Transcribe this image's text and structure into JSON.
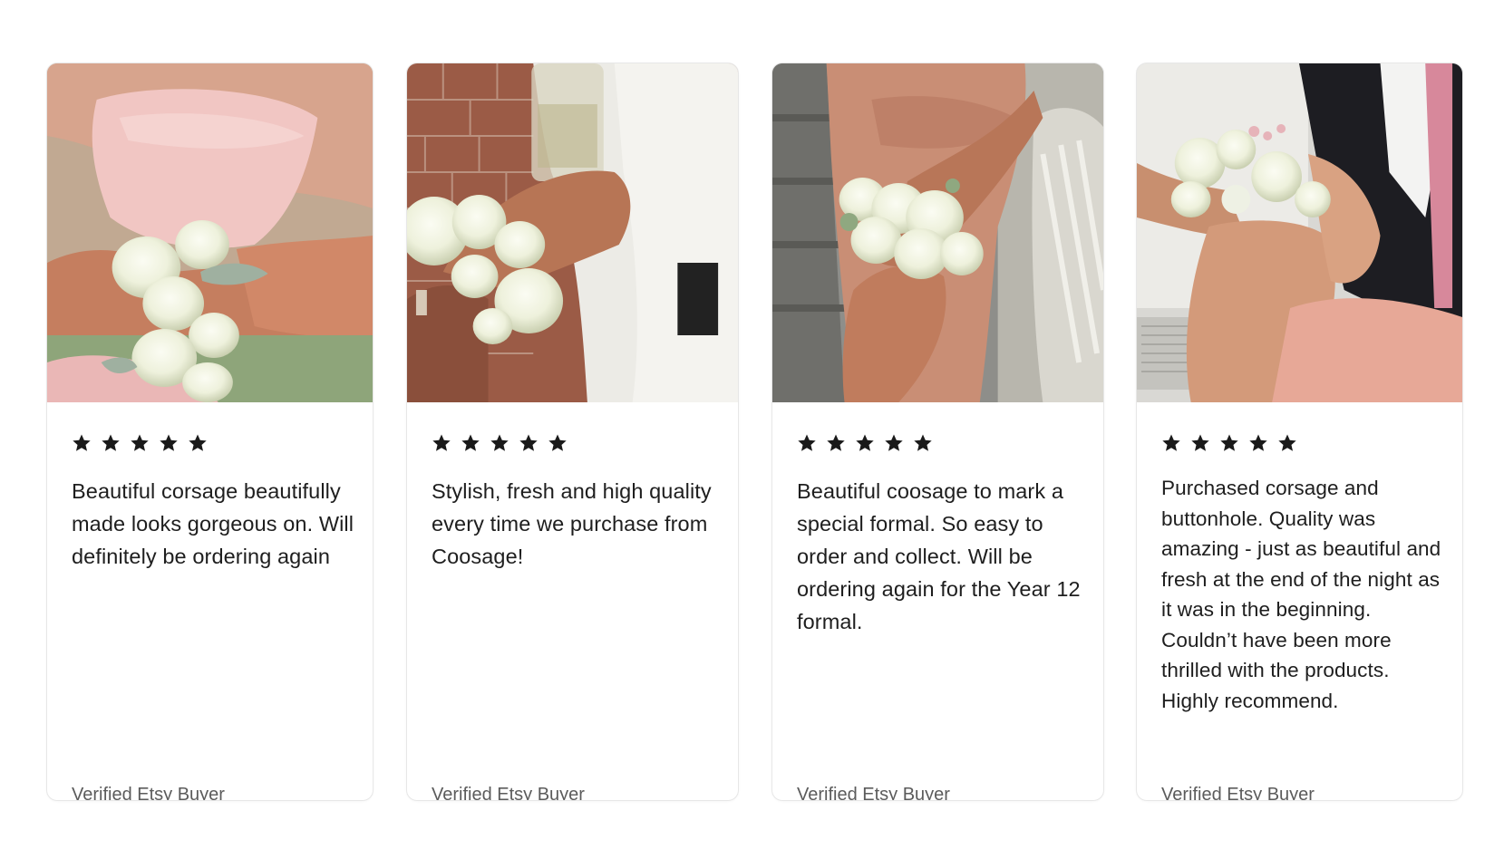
{
  "colors": {
    "card_border": "#e7e7e7",
    "star": "#1a1a1a",
    "text": "#1e1e1e",
    "muted": "#5b5b5b"
  },
  "reviews": [
    {
      "rating": 5,
      "rating_icon": "star-icon",
      "text": "Beautiful corsage beautifully made looks gorgeous on. Will definitely be ordering again",
      "author": "Verified Etsy Buyer"
    },
    {
      "rating": 5,
      "rating_icon": "star-icon",
      "text": "Stylish, fresh and high quality every time we purchase from Coosage!",
      "author": "Verified Etsy Buyer"
    },
    {
      "rating": 5,
      "rating_icon": "star-icon",
      "text": "Beautiful coosage to mark a special formal. So easy to order and collect. Will be ordering again for the Year 12 formal.",
      "author": "Verified Etsy Buyer"
    },
    {
      "rating": 5,
      "rating_icon": "star-icon",
      "text": "Purchased corsage and buttonhole. Quality was amazing - just as beautiful and fresh at the end of the night as it was in the beginning. Couldn’t have been more thrilled with the products. Highly recommend.",
      "author": "Verified Etsy Buyer"
    }
  ]
}
